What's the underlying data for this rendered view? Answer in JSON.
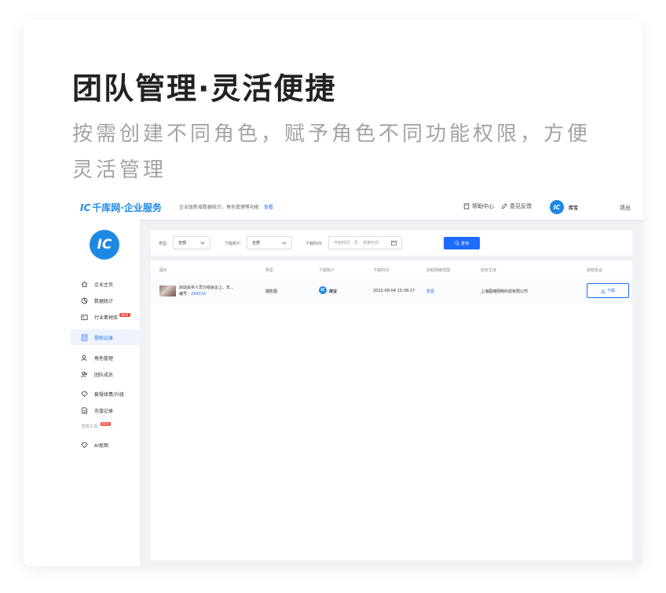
{
  "headline": "团队管理·灵活便捷",
  "subline": "按需创建不同角色，赋予角色不同功能权限，方便灵活管理",
  "app": {
    "logo_mark": "IC",
    "logo_text": "千库网·企业服务",
    "top_note": "企业版新增数据统计，角色管理等功能",
    "top_note_link": "查看",
    "help": "帮助中心",
    "feedback": "意见反馈",
    "avatar_mark": "IC",
    "username": "库宝",
    "logout": "退出",
    "sidebar": {
      "avatar_mark": "IC",
      "items": [
        {
          "label": "企业主页",
          "icon": "home-icon"
        },
        {
          "label": "数据统计",
          "icon": "chart-icon"
        },
        {
          "label": "行业素材库",
          "icon": "library-icon",
          "badge": "NEW"
        },
        {
          "label": "授权记录",
          "icon": "record-icon",
          "active": true
        },
        {
          "label": "角色管理",
          "icon": "role-icon"
        },
        {
          "label": "团队成员",
          "icon": "team-icon"
        },
        {
          "label": "套餐续费/升级",
          "icon": "diamond-icon"
        },
        {
          "label": "充值记录",
          "icon": "doc-icon"
        }
      ],
      "section": "智能工具",
      "section_badge": "NEW",
      "tool": {
        "label": "AI抠图",
        "icon": "diamond-icon"
      }
    },
    "filter": {
      "type_label": "类型:",
      "type_value": "全部",
      "account_label": "下载账户:",
      "account_value": "全部",
      "time_label": "下载时间:",
      "start_placeholder": "开始时间",
      "to": "至",
      "end_placeholder": "结束时间",
      "query": "查询"
    },
    "table": {
      "headers": [
        "图片",
        "类型",
        "下载账户",
        "下载时间",
        "授权网络范围",
        "授权主体",
        "授权协议"
      ],
      "row": {
        "title": "启动会务人员分组会议上、年...",
        "id_label": "编号：",
        "id_value": "299333",
        "type": "摄影图",
        "account_mark": "IC",
        "account": "库宝",
        "time": "2022-08-04 15:38:17",
        "scope": "查看",
        "subject": "上海图魂网络科技有限公司",
        "download": "下载"
      }
    }
  }
}
